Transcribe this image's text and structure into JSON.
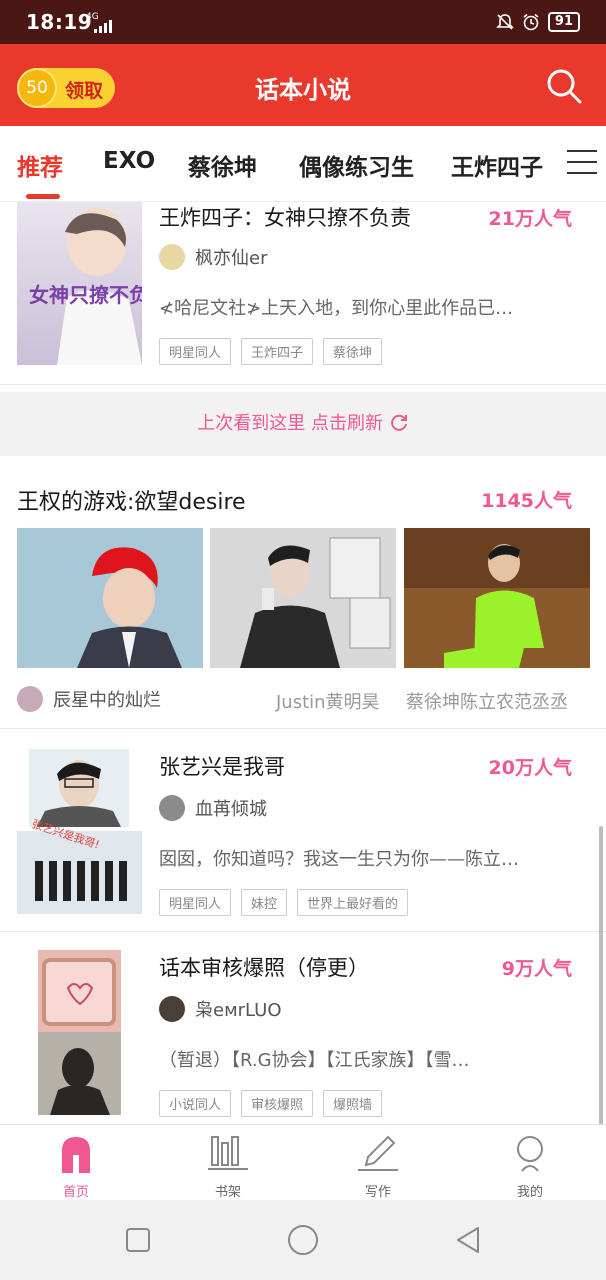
{
  "status_bar": {
    "time": "18:19",
    "network": "4G",
    "battery": "91"
  },
  "app_bar": {
    "coin_amount": "50",
    "coin_label": "领取",
    "title": "话本小说"
  },
  "tabs": [
    "推荐",
    "EXO",
    "蔡徐坤",
    "偶像练习生",
    "王炸四子"
  ],
  "feed": {
    "book1": {
      "title": "王炸四子：女神只撩不负责",
      "popularity": "21万人气",
      "author": "枫亦仙er",
      "description": "≮哈尼文社≯上天入地，到你心里此作品已…",
      "tags": [
        "明星同人",
        "王炸四子",
        "蔡徐坤"
      ],
      "cover_text": "女神只撩不负责"
    },
    "refresh_text": "上次看到这里 点击刷新",
    "gallery": {
      "title": "王权的游戏:欲望desire",
      "popularity": "1145人气",
      "author": "辰星中的灿烂",
      "actors": [
        "Justin黄明昊",
        "蔡徐坤陈立农范丞丞"
      ]
    },
    "book2": {
      "title": "张艺兴是我哥",
      "popularity": "20万人气",
      "author": "血苒倾城",
      "description": "囡囡，你知道吗？我这一生只为你——陈立…",
      "tags": [
        "明星同人",
        "妹控",
        "世界上最好看的"
      ],
      "cover_text": "张艺兴是我哥!"
    },
    "book3": {
      "title": "话本审核爆照（停更）",
      "popularity": "9万人气",
      "author": "枭eмrLUO",
      "description": "（暂退）【R.G协会】【江氏家族】【雪…",
      "tags": [
        "小说同人",
        "审核爆照",
        "爆照墙"
      ]
    }
  },
  "bottom_nav": [
    "首页",
    "书架",
    "写作",
    "我的"
  ],
  "colors": {
    "brand_red": "#e8392c",
    "accent_pink": "#f05894",
    "coin_yellow": "#fcd233"
  }
}
